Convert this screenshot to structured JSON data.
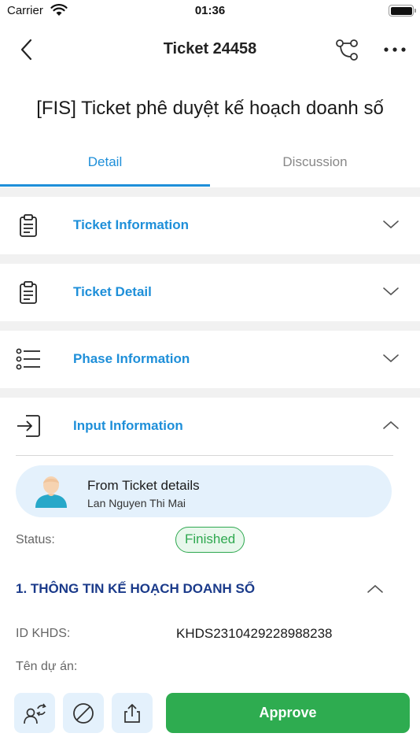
{
  "status_bar": {
    "carrier": "Carrier",
    "time": "01:36"
  },
  "nav": {
    "title": "Ticket 24458"
  },
  "ticket_title": "[FIS] Ticket phê duyệt kế hoạch doanh số",
  "tabs": [
    {
      "label": "Detail",
      "active": true
    },
    {
      "label": "Discussion",
      "active": false
    }
  ],
  "sections": [
    {
      "label": "Ticket Information",
      "icon": "clipboard-icon",
      "expanded": false
    },
    {
      "label": "Ticket Detail",
      "icon": "clipboard-icon",
      "expanded": false
    },
    {
      "label": "Phase Information",
      "icon": "list-icon",
      "expanded": false
    },
    {
      "label": "Input Information",
      "icon": "login-icon",
      "expanded": true
    }
  ],
  "input_info": {
    "from_title": "From Ticket details",
    "from_name": "Lan Nguyen Thi Mai",
    "status_label": "Status:",
    "status_value": "Finished",
    "subsection_title": "1.  THÔNG TIN KẾ HOẠCH DOANH SỐ",
    "fields": [
      {
        "label": "ID KHDS:",
        "value": "KHDS2310429228988238"
      },
      {
        "label": "Tên dự án:",
        "value": ""
      }
    ]
  },
  "actions": {
    "approve_label": "Approve"
  },
  "colors": {
    "accent": "#1e8fd9",
    "approve": "#2eac50",
    "status_green": "#2ea84f",
    "heading_navy": "#1a3a8a"
  }
}
